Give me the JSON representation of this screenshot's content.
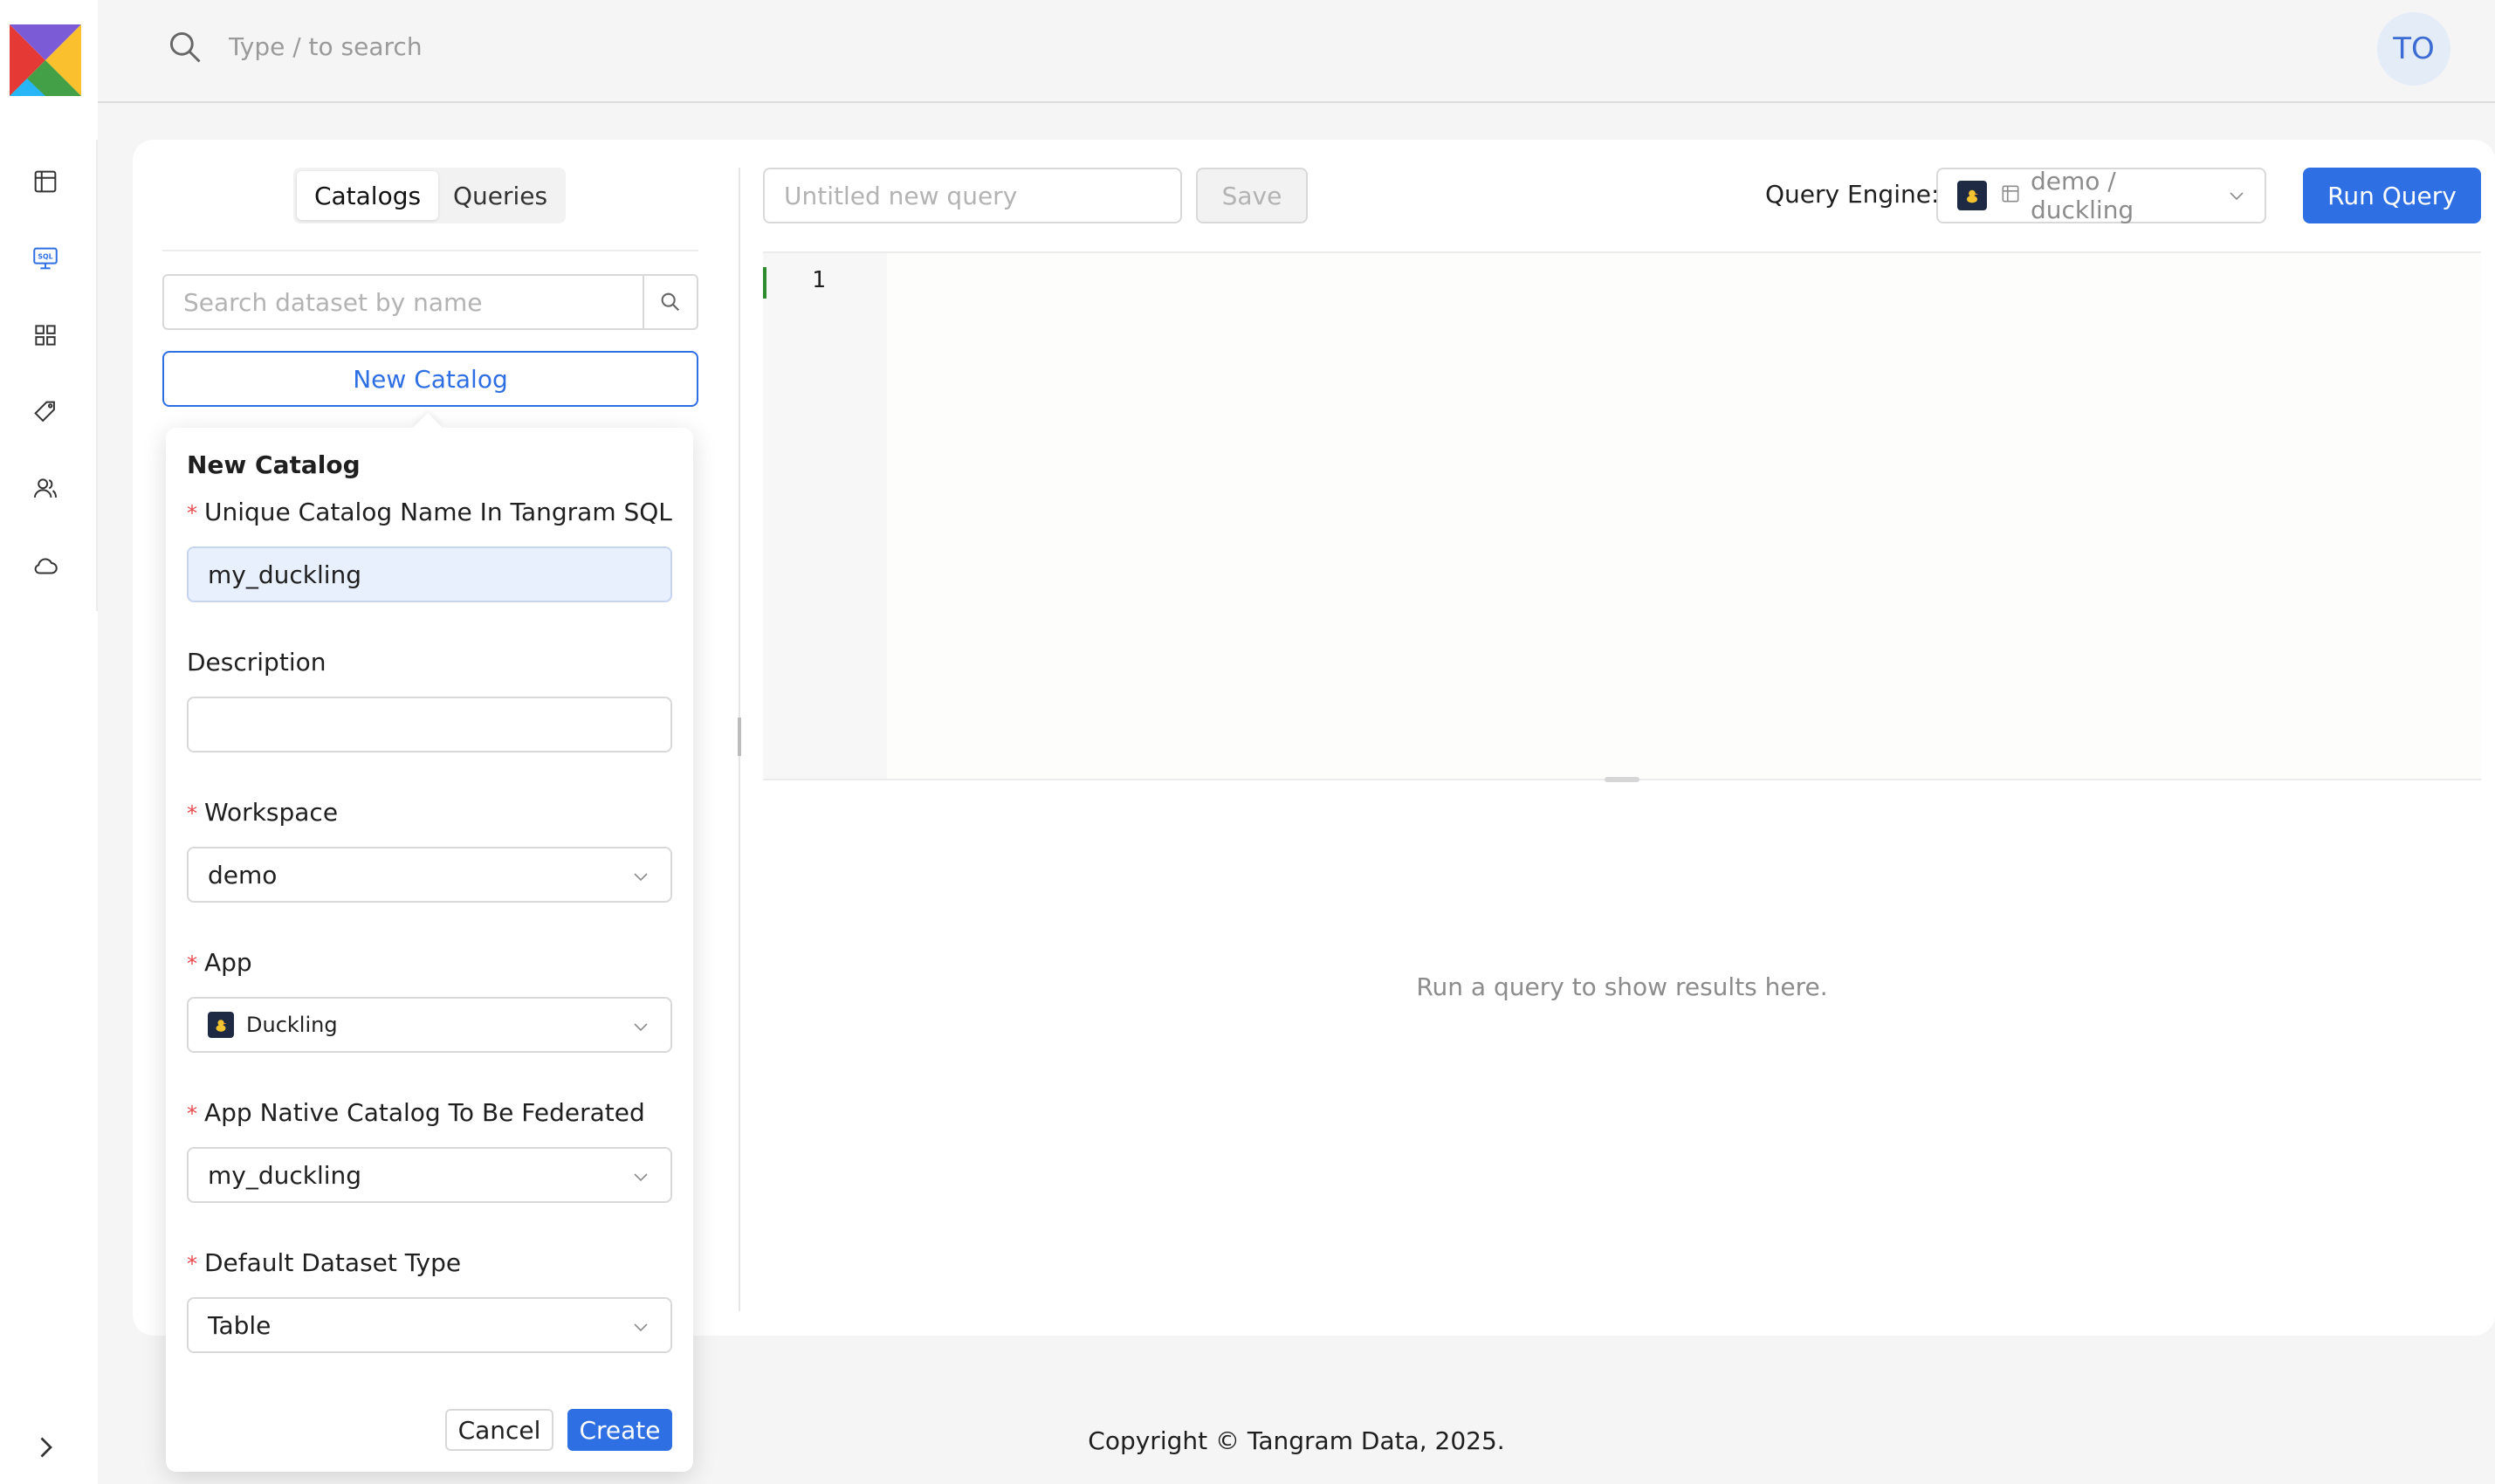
{
  "topbar": {
    "search_placeholder": "Type / to search",
    "avatar_initials": "TO"
  },
  "sidebar": {
    "items": [
      {
        "name": "dataset-icon"
      },
      {
        "name": "sql-icon",
        "active": true
      },
      {
        "name": "apps-grid-icon"
      },
      {
        "name": "tag-icon"
      },
      {
        "name": "users-icon"
      },
      {
        "name": "cloud-icon"
      }
    ],
    "collapse_icon": "chevron-right-icon"
  },
  "left_panel": {
    "tabs": [
      {
        "label": "Catalogs",
        "active": true
      },
      {
        "label": "Queries",
        "active": false
      }
    ],
    "dataset_search_placeholder": "Search dataset by name",
    "new_catalog_label": "New Catalog"
  },
  "popover": {
    "title": "New Catalog",
    "fields": {
      "catalog_name": {
        "label": "Unique Catalog Name In Tangram SQL",
        "required": true,
        "value": "my_duckling"
      },
      "description": {
        "label": "Description",
        "required": false,
        "value": ""
      },
      "workspace": {
        "label": "Workspace",
        "required": true,
        "value": "demo"
      },
      "app": {
        "label": "App",
        "required": true,
        "value": "Duckling"
      },
      "native_catalog": {
        "label": "App Native Catalog To Be Federated",
        "required": true,
        "value": "my_duckling"
      },
      "dataset_type": {
        "label": "Default Dataset Type",
        "required": true,
        "value": "Table"
      }
    },
    "required_marker": "*",
    "cancel_label": "Cancel",
    "create_label": "Create"
  },
  "query_toolbar": {
    "query_name_placeholder": "Untitled new query",
    "save_label": "Save",
    "engine_label": "Query Engine:",
    "engine_value": "demo / duckling",
    "run_label": "Run Query"
  },
  "editor": {
    "line_numbers": [
      "1"
    ]
  },
  "results": {
    "empty_message": "Run a query to show results here."
  },
  "footer": {
    "copyright": "Copyright © Tangram Data, 2025."
  },
  "colors": {
    "accent": "#2f6fe4",
    "required": "#e5484d",
    "cursor": "#2e8b2e"
  }
}
